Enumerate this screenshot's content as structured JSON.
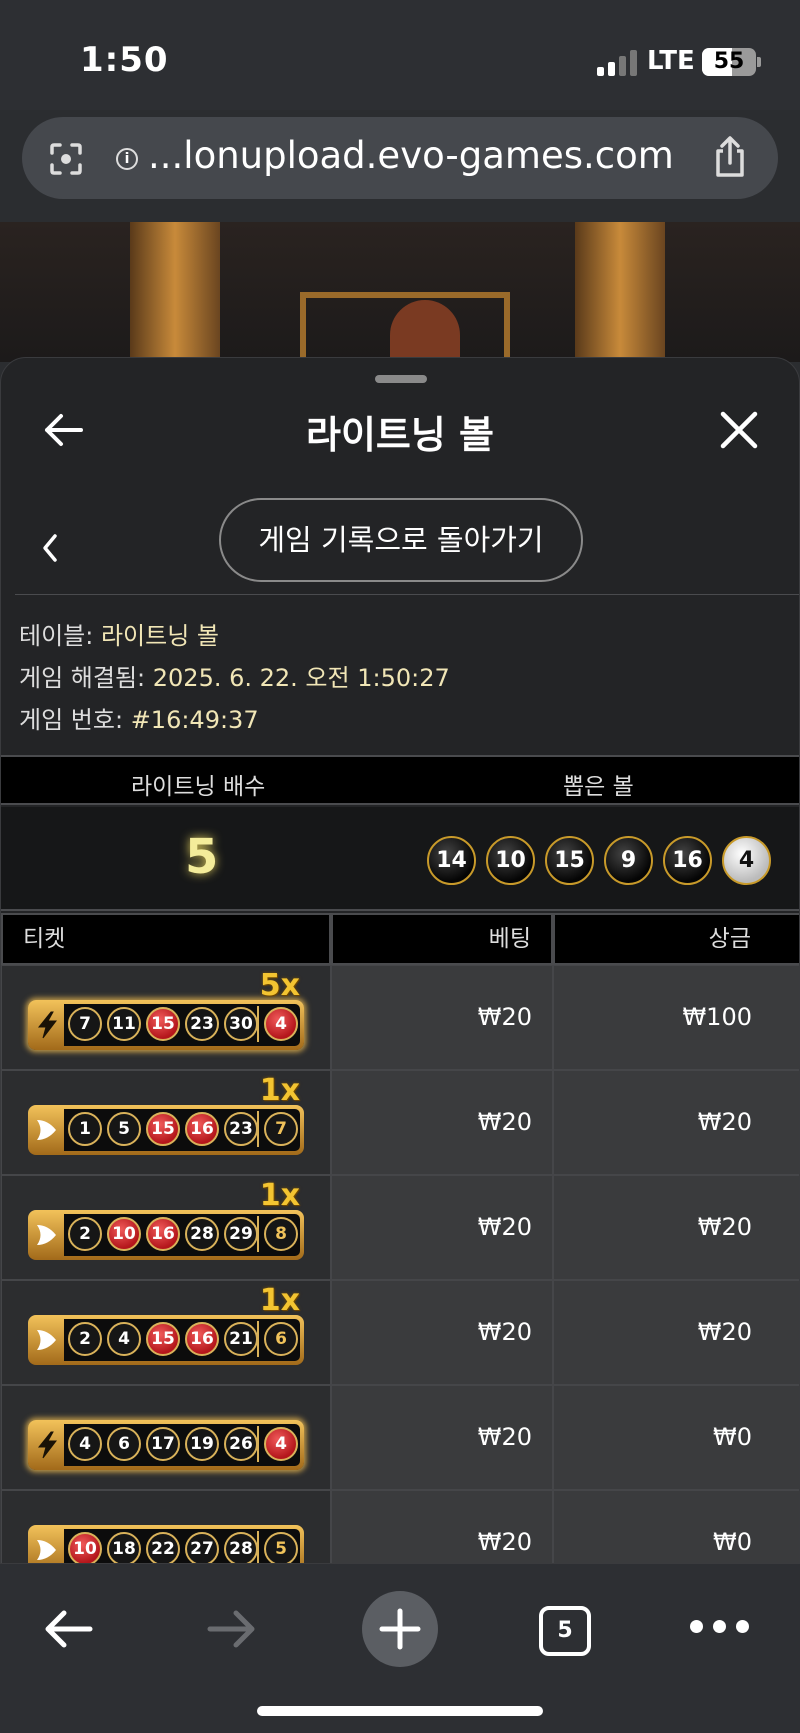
{
  "status": {
    "time": "1:50",
    "network": "LTE",
    "battery": "55"
  },
  "browser": {
    "url": "...lonupload.evo-games.com",
    "tab_count": "5"
  },
  "sheet": {
    "title": "라이트닝 볼",
    "history_button": "게임 기록으로 돌아가기",
    "table_label": "테이블:",
    "table_value": "라이트닝 볼",
    "resolved_label": "게임 해결됨:",
    "resolved_value": "2025. 6. 22. 오전 1:50:27",
    "game_number_label": "게임 번호:",
    "game_number_value": "#16:49:37"
  },
  "lightning": {
    "multiplier_header": "라이트닝 배수",
    "drawn_header": "뽑은 볼",
    "multiplier": "5",
    "drawn_balls": [
      "14",
      "10",
      "15",
      "9",
      "16",
      "4"
    ]
  },
  "tickets": {
    "headers": {
      "ticket": "티켓",
      "bet": "베팅",
      "prize": "상금"
    },
    "rows": [
      {
        "type": "lightning",
        "badge": "5x",
        "balls": [
          {
            "n": "7",
            "red": false
          },
          {
            "n": "11",
            "red": false
          },
          {
            "n": "15",
            "red": true
          },
          {
            "n": "23",
            "red": false
          },
          {
            "n": "30",
            "red": false
          }
        ],
        "extra": {
          "n": "4",
          "red": true
        },
        "bet": "₩20",
        "prize": "₩100"
      },
      {
        "type": "standard",
        "badge": "1x",
        "balls": [
          {
            "n": "1",
            "red": false
          },
          {
            "n": "5",
            "red": false
          },
          {
            "n": "15",
            "red": true
          },
          {
            "n": "16",
            "red": true
          },
          {
            "n": "23",
            "red": false
          }
        ],
        "extra": {
          "n": "7",
          "red": false
        },
        "bet": "₩20",
        "prize": "₩20"
      },
      {
        "type": "standard",
        "badge": "1x",
        "balls": [
          {
            "n": "2",
            "red": false
          },
          {
            "n": "10",
            "red": true
          },
          {
            "n": "16",
            "red": true
          },
          {
            "n": "28",
            "red": false
          },
          {
            "n": "29",
            "red": false
          }
        ],
        "extra": {
          "n": "8",
          "red": false
        },
        "bet": "₩20",
        "prize": "₩20"
      },
      {
        "type": "standard",
        "badge": "1x",
        "balls": [
          {
            "n": "2",
            "red": false
          },
          {
            "n": "4",
            "red": false
          },
          {
            "n": "15",
            "red": true
          },
          {
            "n": "16",
            "red": true
          },
          {
            "n": "21",
            "red": false
          }
        ],
        "extra": {
          "n": "6",
          "red": false
        },
        "bet": "₩20",
        "prize": "₩20"
      },
      {
        "type": "lightning",
        "badge": "",
        "balls": [
          {
            "n": "4",
            "red": false
          },
          {
            "n": "6",
            "red": false
          },
          {
            "n": "17",
            "red": false
          },
          {
            "n": "19",
            "red": false
          },
          {
            "n": "26",
            "red": false
          }
        ],
        "extra": {
          "n": "4",
          "red": true
        },
        "bet": "₩20",
        "prize": "₩0"
      },
      {
        "type": "standard",
        "badge": "",
        "balls": [
          {
            "n": "10",
            "red": true
          },
          {
            "n": "18",
            "red": false
          },
          {
            "n": "22",
            "red": false
          },
          {
            "n": "27",
            "red": false
          },
          {
            "n": "28",
            "red": false
          }
        ],
        "extra": {
          "n": "5",
          "red": false
        },
        "bet": "₩20",
        "prize": "₩0"
      }
    ]
  },
  "colors": {
    "accent_gold": "#f3c431",
    "ball_red": "#b4161b",
    "info_value": "#f1e6b6",
    "multiplier_glow": "#f4ec9a"
  },
  "icons": [
    "camera-search-icon",
    "info-icon",
    "share-icon",
    "back-arrow-icon",
    "close-icon",
    "chevron-left-icon",
    "lightning-icon",
    "arrow-chevron-icon",
    "plus-icon",
    "more-icon"
  ]
}
